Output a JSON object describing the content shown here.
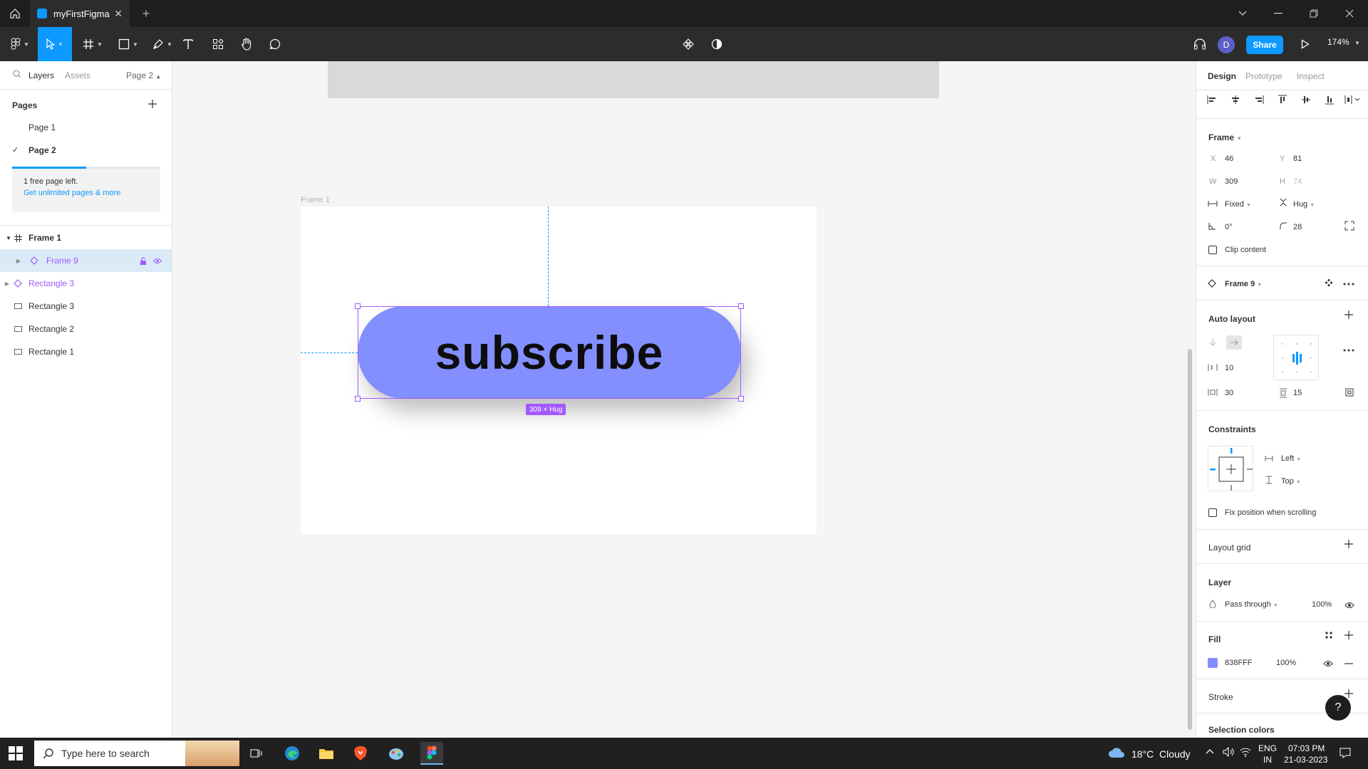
{
  "tabbar": {
    "file_tab": "myFirstFigma",
    "close_glyph": "✕",
    "plus_glyph": "+"
  },
  "toolbar": {
    "share_label": "Share",
    "avatar_initial": "D",
    "zoom": "174%"
  },
  "left_panel": {
    "tabs": [
      "Layers",
      "Assets"
    ],
    "page_selector": "Page 2",
    "pages_title": "Pages",
    "pages": [
      "Page 1",
      "Page 2"
    ],
    "current_page": "Page 2",
    "free_pages_progress": 0.5,
    "free_pages_text": "1 free page left.",
    "upgrade_link": "Get unlimited pages & more",
    "layers": [
      {
        "name": "Frame 1",
        "type": "frame"
      },
      {
        "name": "Frame 9",
        "type": "component"
      },
      {
        "name": "Rectangle 3",
        "type": "component"
      },
      {
        "name": "Rectangle 3",
        "type": "rectangle"
      },
      {
        "name": "Rectangle 2",
        "type": "rectangle"
      },
      {
        "name": "Rectangle 1",
        "type": "rectangle"
      }
    ]
  },
  "canvas": {
    "frame_label": "Frame 1",
    "button_text": "subscribe",
    "size_badge": "309 × Hug",
    "button_color": "#838FFF"
  },
  "right_panel": {
    "tabs": [
      "Design",
      "Prototype",
      "Inspect"
    ],
    "frame_section": "Frame",
    "x_label": "X",
    "x": "46",
    "y_label": "Y",
    "y": "81",
    "w_label": "W",
    "w": "309",
    "h_label": "H",
    "h": "74",
    "width_mode": "Fixed",
    "height_mode": "Hug",
    "rotation": "0°",
    "radius": "28",
    "clip_content": "Clip content",
    "component_name": "Frame 9",
    "auto_layout_title": "Auto layout",
    "spacing": "10",
    "padding_h": "30",
    "padding_v": "15",
    "constraints_title": "Constraints",
    "constraint_h": "Left",
    "constraint_v": "Top",
    "fix_position": "Fix position when scrolling",
    "layout_grid_title": "Layout grid",
    "layer_title": "Layer",
    "blend_mode": "Pass through",
    "layer_opacity": "100%",
    "fill_title": "Fill",
    "fill_hex": "838FFF",
    "fill_opacity": "100%",
    "stroke_title": "Stroke",
    "selection_colors_title": "Selection colors",
    "help_glyph": "?"
  },
  "taskbar": {
    "search_placeholder": "Type here to search",
    "weather": "18°C  Cloudy",
    "lang": "ENG",
    "region": "IN",
    "time": "07:03 PM",
    "date": "21-03-2023"
  }
}
